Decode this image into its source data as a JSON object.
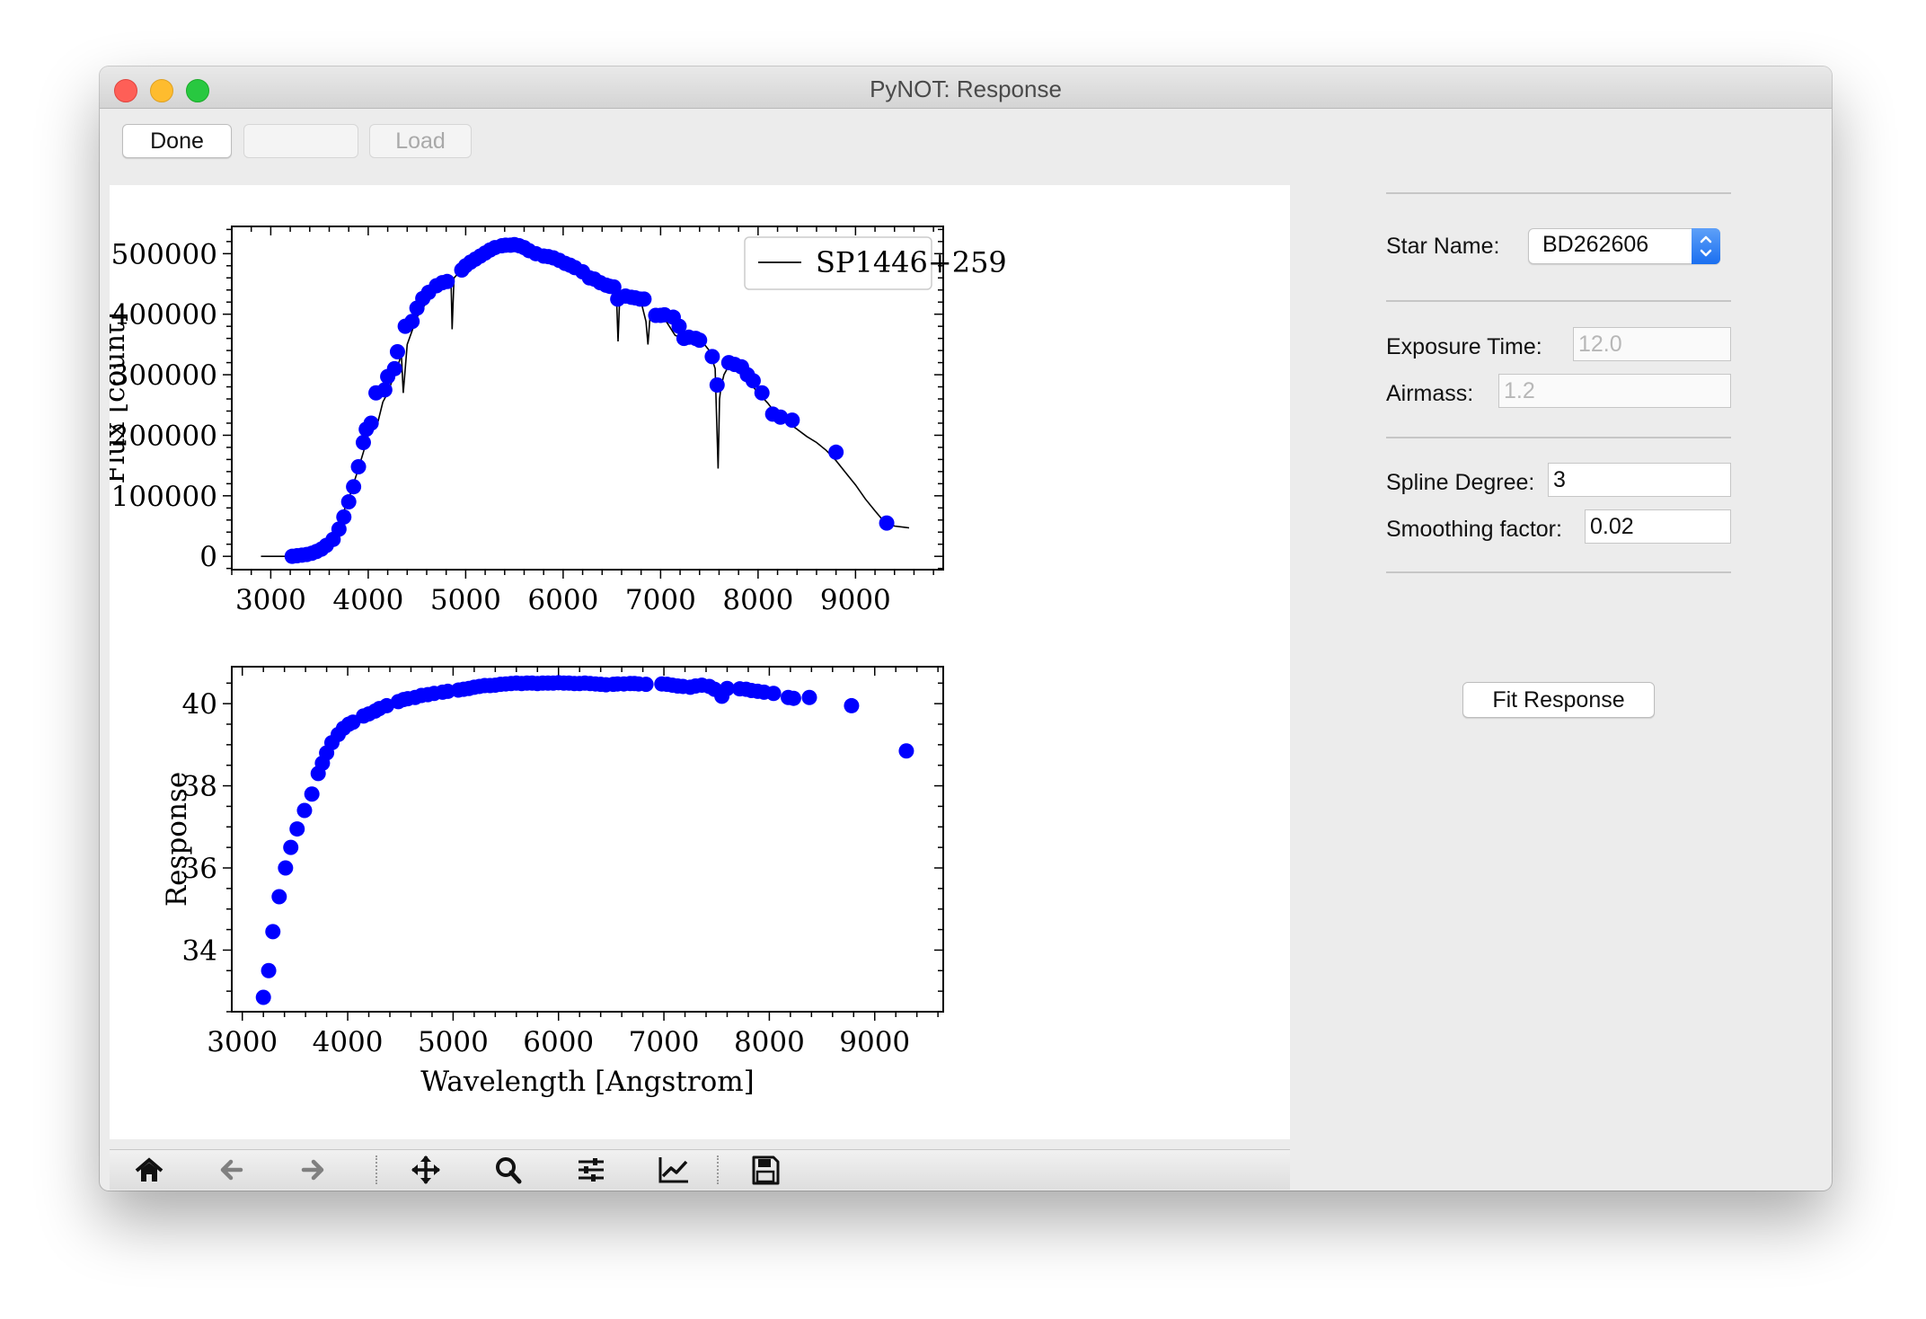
{
  "window": {
    "title": "PyNOT: Response"
  },
  "toolbar": {
    "done_label": "Done",
    "blank_label": "",
    "load_label": "Load"
  },
  "panel": {
    "star_name_label": "Star Name:",
    "star_name_value": "BD262606",
    "exposure_time_label": "Exposure Time:",
    "exposure_time_value": "12.0",
    "airmass_label": "Airmass:",
    "airmass_value": "1.2",
    "spline_degree_label": "Spline Degree:",
    "spline_degree_value": "3",
    "smoothing_factor_label": "Smoothing factor:",
    "smoothing_factor_value": "0.02",
    "fit_button_label": "Fit Response"
  },
  "navbar": {
    "icons": [
      "home-icon",
      "back-arrow-icon",
      "forward-arrow-icon",
      "pan-icon",
      "zoom-icon",
      "configure-subplots-icon",
      "edit-axis-icon",
      "save-icon"
    ]
  },
  "chart_data": [
    {
      "type": "line",
      "ylabel": "Flux  [count]",
      "xlabel": "",
      "xlim": [
        2600,
        9900
      ],
      "ylim": [
        -22000,
        545000
      ],
      "xticks": [
        "3000",
        "4000",
        "5000",
        "6000",
        "7000",
        "8000",
        "9000"
      ],
      "yticks": [
        "0",
        "100000",
        "200000",
        "300000",
        "400000",
        "500000"
      ],
      "legend": {
        "position": "top-right",
        "entries": [
          "SP1446+259"
        ]
      },
      "line_color": "#000000",
      "marker_color": "#0000ff",
      "series": [
        {
          "name": "SP1446+259",
          "x": [
            2900,
            3150,
            3200,
            3300,
            3400,
            3500,
            3600,
            3700,
            3800,
            3900,
            3950,
            4000,
            4050,
            4100,
            4150,
            4200,
            4250,
            4300,
            4340,
            4360,
            4400,
            4500,
            4600,
            4700,
            4800,
            4850,
            4861,
            4880,
            4950,
            5000,
            5100,
            5200,
            5300,
            5400,
            5500,
            5600,
            5700,
            5800,
            5900,
            6000,
            6100,
            6200,
            6300,
            6400,
            6500,
            6550,
            6563,
            6580,
            6650,
            6700,
            6800,
            6850,
            6870,
            6890,
            6950,
            7050,
            7150,
            7250,
            7350,
            7450,
            7500,
            7560,
            7590,
            7605,
            7620,
            7650,
            7700,
            7800,
            7900,
            8000,
            8100,
            8200,
            8300,
            8400,
            8500,
            8600,
            8700,
            8800,
            8900,
            9000,
            9100,
            9200,
            9300,
            9400,
            9500,
            9550
          ],
          "y": [
            0,
            0,
            1500,
            4000,
            9000,
            17000,
            30000,
            55000,
            95000,
            145000,
            172000,
            200000,
            208000,
            222000,
            255000,
            270000,
            292000,
            312000,
            334000,
            270000,
            350000,
            395000,
            420000,
            440000,
            452000,
            455000,
            375000,
            460000,
            472000,
            482000,
            493000,
            502000,
            510000,
            514000,
            516000,
            511000,
            502000,
            496000,
            488000,
            482000,
            472000,
            465000,
            453000,
            446000,
            438000,
            420000,
            355000,
            425000,
            430000,
            427000,
            420000,
            388000,
            350000,
            392000,
            395000,
            390000,
            365000,
            360000,
            357000,
            350000,
            340000,
            310000,
            145000,
            260000,
            280000,
            300000,
            315000,
            305000,
            290000,
            270000,
            253000,
            232000,
            222000,
            210000,
            198000,
            188000,
            175000,
            158000,
            138000,
            118000,
            95000,
            75000,
            56000,
            50000,
            48000,
            47000
          ]
        },
        {
          "name": "points",
          "x": [
            3220,
            3270,
            3320,
            3370,
            3420,
            3470,
            3520,
            3570,
            3640,
            3700,
            3750,
            3800,
            3850,
            3900,
            3950,
            3980,
            4030,
            4080,
            4170,
            4200,
            4270,
            4300,
            4380,
            4450,
            4500,
            4560,
            4620,
            4700,
            4760,
            4810,
            4960,
            5000,
            5050,
            5100,
            5150,
            5200,
            5250,
            5300,
            5370,
            5410,
            5460,
            5500,
            5550,
            5600,
            5650,
            5720,
            5800,
            5850,
            5900,
            5960,
            6020,
            6070,
            6120,
            6200,
            6270,
            6320,
            6380,
            6440,
            6480,
            6520,
            6560,
            6640,
            6700,
            6740,
            6790,
            6830,
            6950,
            7000,
            7040,
            7130,
            7190,
            7240,
            7290,
            7360,
            7400,
            7530,
            7580,
            7700,
            7760,
            7830,
            7890,
            7950,
            8040,
            8150,
            8230,
            8350,
            8800,
            9320
          ],
          "y": [
            0,
            1000,
            2000,
            3000,
            5000,
            8000,
            12000,
            18000,
            28000,
            45000,
            65000,
            90000,
            115000,
            148000,
            188000,
            210000,
            220000,
            270000,
            275000,
            297000,
            310000,
            338000,
            380000,
            388000,
            410000,
            426000,
            436000,
            447000,
            452000,
            454000,
            473000,
            480000,
            486000,
            491000,
            496000,
            501000,
            506000,
            510000,
            513000,
            514000,
            514000,
            515000,
            513000,
            510000,
            505000,
            500000,
            496000,
            495000,
            493000,
            489000,
            484000,
            481000,
            477000,
            470000,
            460000,
            458000,
            452000,
            448000,
            446000,
            445000,
            425000,
            430000,
            428000,
            427000,
            425000,
            425000,
            398000,
            398000,
            399000,
            395000,
            380000,
            360000,
            362000,
            360000,
            357000,
            330000,
            283000,
            320000,
            317000,
            313000,
            300000,
            290000,
            270000,
            235000,
            230000,
            225000,
            172000,
            55000
          ]
        }
      ]
    },
    {
      "type": "scatter",
      "xlabel": "Wavelength  [Angstrom]",
      "ylabel": "Response",
      "xlim": [
        2900,
        9650
      ],
      "ylim": [
        32.5,
        40.9
      ],
      "xticks": [
        "3000",
        "4000",
        "5000",
        "6000",
        "7000",
        "8000",
        "9000"
      ],
      "yticks": [
        "34",
        "36",
        "38",
        "40"
      ],
      "marker_color": "#0000ff",
      "series": [
        {
          "name": "response",
          "x": [
            3200,
            3250,
            3290,
            3350,
            3410,
            3460,
            3520,
            3590,
            3660,
            3720,
            3760,
            3800,
            3850,
            3910,
            3960,
            4010,
            4050,
            4150,
            4200,
            4260,
            4300,
            4370,
            4480,
            4530,
            4570,
            4640,
            4700,
            4760,
            4820,
            4900,
            4950,
            5050,
            5100,
            5150,
            5200,
            5250,
            5300,
            5350,
            5400,
            5450,
            5500,
            5550,
            5600,
            5650,
            5700,
            5750,
            5800,
            5850,
            5900,
            5950,
            6000,
            6050,
            6100,
            6150,
            6200,
            6250,
            6300,
            6350,
            6400,
            6450,
            6520,
            6560,
            6620,
            6680,
            6720,
            6760,
            6830,
            6980,
            7030,
            7080,
            7130,
            7180,
            7250,
            7300,
            7360,
            7430,
            7480,
            7550,
            7600,
            7720,
            7780,
            7830,
            7890,
            7950,
            8040,
            8180,
            8230,
            8380,
            8780,
            9300
          ],
          "y": [
            32.85,
            33.5,
            34.45,
            35.3,
            36.0,
            36.5,
            36.95,
            37.4,
            37.8,
            38.3,
            38.55,
            38.8,
            39.05,
            39.25,
            39.4,
            39.5,
            39.55,
            39.7,
            39.75,
            39.82,
            39.88,
            39.95,
            40.05,
            40.1,
            40.12,
            40.15,
            40.2,
            40.22,
            40.25,
            40.28,
            40.3,
            40.33,
            40.35,
            40.37,
            40.4,
            40.42,
            40.44,
            40.44,
            40.45,
            40.47,
            40.48,
            40.49,
            40.5,
            40.49,
            40.5,
            40.5,
            40.49,
            40.5,
            40.5,
            40.5,
            40.51,
            40.5,
            40.5,
            40.49,
            40.49,
            40.5,
            40.49,
            40.48,
            40.47,
            40.46,
            40.47,
            40.48,
            40.48,
            40.49,
            40.49,
            40.48,
            40.47,
            40.48,
            40.47,
            40.45,
            40.43,
            40.42,
            40.4,
            40.43,
            40.45,
            40.42,
            40.35,
            40.18,
            40.37,
            40.36,
            40.35,
            40.32,
            40.3,
            40.28,
            40.25,
            40.15,
            40.13,
            40.15,
            39.95,
            38.85
          ]
        }
      ]
    }
  ]
}
